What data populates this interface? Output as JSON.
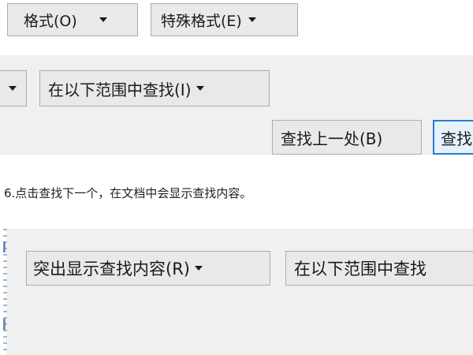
{
  "top_dialog": {
    "format_button": {
      "label": "格式(O)"
    },
    "special_format_button": {
      "label": "特殊格式(E)"
    }
  },
  "middle_dialog": {
    "find_in_button": {
      "label": "在以下范围中查找(I)"
    },
    "find_previous_button": {
      "label": "查找上一处(B)"
    },
    "find_next_button_partial": {
      "label": "查找"
    }
  },
  "caption": "6.点击查找下一个，在文档中会显示查找内容。",
  "bottom_dialog": {
    "highlight_button": {
      "label": "突出显示查找内容(R)"
    },
    "find_in_button": {
      "label": "在以下范围中查找"
    }
  },
  "colors": {
    "panel": "#f0f0f0",
    "button": "#e9e9e9",
    "button_border": "#adadad",
    "focus_border": "#2b7bd2"
  }
}
